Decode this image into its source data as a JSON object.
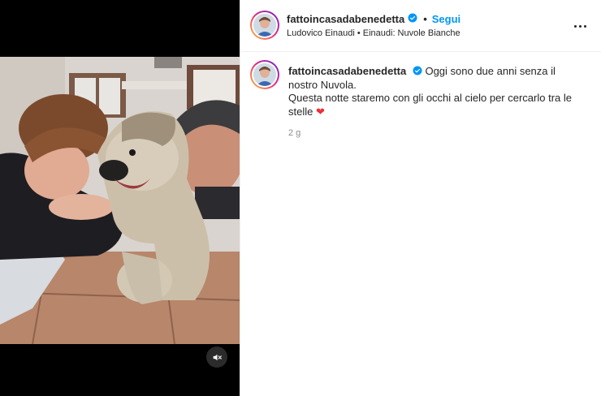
{
  "post": {
    "username": "fattoincasadabenedetta",
    "follow_label": "Segui",
    "separator": "•",
    "audio": "Ludovico Einaudi • Einaudi: Nuvole Bianche",
    "more_icon": "more-options-icon",
    "verified_icon": "verified-badge-icon",
    "accent_color": "#0095f6"
  },
  "caption": {
    "username": "fattoincasadabenedetta",
    "line1": "Oggi sono due anni senza il nostro Nuvola.",
    "line2": "Questa notte staremo con gli occhi al cielo per cercarlo tra le stelle",
    "emoji": "❤",
    "time": "2 g"
  },
  "media": {
    "mute_icon": "speaker-muted-icon"
  }
}
